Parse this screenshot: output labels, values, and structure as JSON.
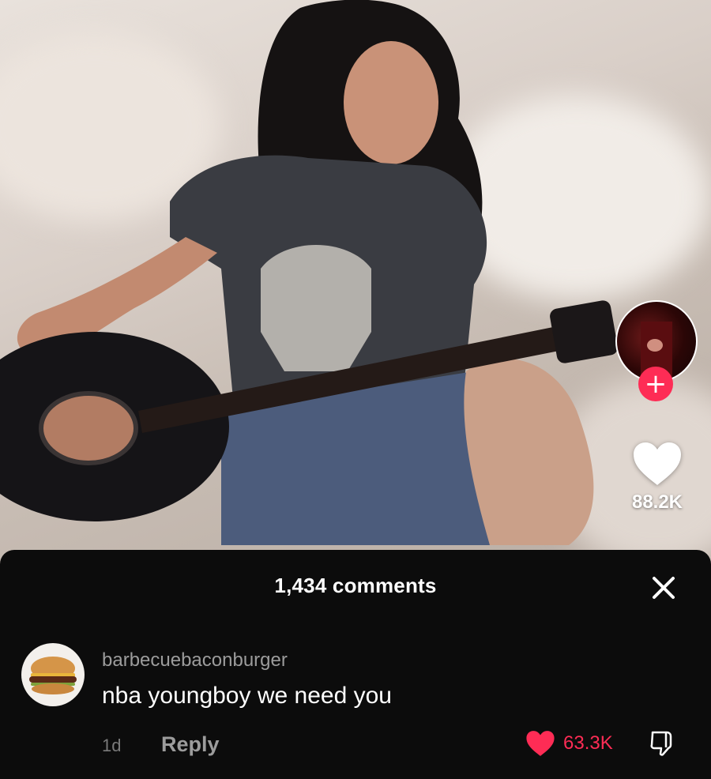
{
  "video": {
    "creator_avatar": "creator-avatar",
    "follow_icon": "plus-icon",
    "follow_label": "+",
    "like_icon": "heart-icon",
    "like_count": "88.2K"
  },
  "comments_panel": {
    "title": "1,434 comments",
    "close_icon": "close-icon",
    "comments": [
      {
        "avatar": "burger-avatar",
        "username": "barbecuebaconburger",
        "text": "nba youngboy we need you",
        "time": "1d",
        "reply_label": "Reply",
        "like_icon": "heart-icon",
        "like_count": "63.3K",
        "dislike_icon": "thumbs-down-icon"
      }
    ]
  },
  "colors": {
    "accent": "#fe2c55",
    "sheet_bg": "#0c0c0c",
    "muted_text": "#9c9c9c"
  }
}
